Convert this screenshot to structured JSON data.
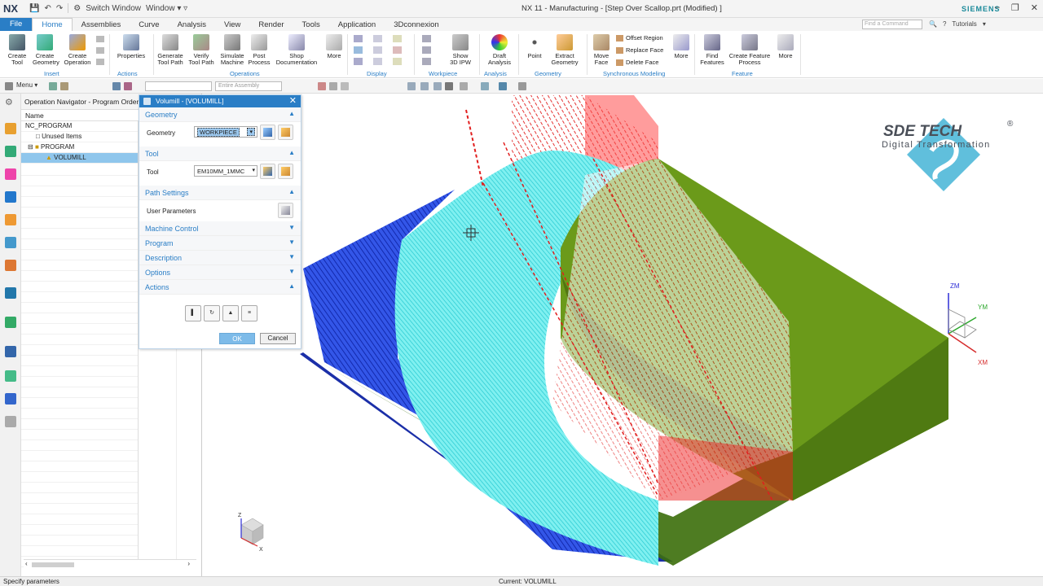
{
  "app": {
    "logo": "NX",
    "window_title": "NX 11 - Manufacturing - [Step Over Scallop.prt (Modified) ]",
    "brand": "SIEMENS",
    "qat": {
      "switch_window": "Switch Window",
      "window": "Window ▾ ▿"
    }
  },
  "ribbon_tabs": [
    "File",
    "Home",
    "Assemblies",
    "Curve",
    "Analysis",
    "View",
    "Render",
    "Tools",
    "Application",
    "3Dconnexion"
  ],
  "command_search_placeholder": "Find a Command",
  "tutorials": "Tutorials",
  "ribbon": {
    "insert": {
      "group": "Insert",
      "create_tool": "Create\nTool",
      "create_geometry": "Create\nGeometry",
      "create_operation": "Create\nOperation"
    },
    "actions": {
      "group": "Actions",
      "properties": "Properties"
    },
    "operations": {
      "group": "Operations",
      "generate": "Generate\nTool Path",
      "verify": "Verify\nTool Path",
      "simulate": "Simulate\nMachine",
      "post": "Post\nProcess",
      "shop": "Shop\nDocumentation",
      "more": "More"
    },
    "display": {
      "group": "Display"
    },
    "workpiece": {
      "group": "Workpiece",
      "show_ipw": "Show\n3D IPW"
    },
    "analysis": {
      "group": "Analysis",
      "draft": "Draft\nAnalysis"
    },
    "geometry": {
      "group": "Geometry",
      "point": "Point",
      "extract": "Extract\nGeometry"
    },
    "sync": {
      "group": "Synchronous Modeling",
      "move_face": "Move\nFace",
      "offset_region": "Offset Region",
      "replace_face": "Replace Face",
      "delete_face": "Delete Face",
      "more": "More"
    },
    "feature": {
      "group": "Feature",
      "find": "Find\nFeatures",
      "create_process": "Create Feature\nProcess",
      "more": "More"
    }
  },
  "toolbar2": {
    "menu": "Menu ▾",
    "filter": "",
    "assembly": "Entire Assembly"
  },
  "navigator": {
    "title": "Operation Navigator - Program Order",
    "column_name": "Name",
    "rows": [
      "NC_PROGRAM",
      "Unused Items",
      "PROGRAM",
      "VOLUMILL"
    ]
  },
  "dialog": {
    "title": "Volumill - [VOLUMILL]",
    "sections": {
      "geometry": "Geometry",
      "tool": "Tool",
      "path_settings": "Path Settings",
      "machine_control": "Machine Control",
      "program": "Program",
      "description": "Description",
      "options": "Options",
      "actions": "Actions"
    },
    "geometry_label": "Geometry",
    "geometry_value": "WORKPIECE",
    "tool_label": "Tool",
    "tool_value": "EM10MM_1MMC",
    "user_params_label": "User Parameters",
    "ok": "OK",
    "cancel": "Cancel"
  },
  "viewport": {
    "logo_main": "SDE TECH",
    "logo_sub": "Digital Transformation",
    "triad_labels": {
      "zm": "ZM",
      "ym": "YM",
      "xm": "XM"
    },
    "mini_triad": {
      "z": "Z",
      "x": "X"
    },
    "colors": {
      "toolpath_blue": "#1b3fd1",
      "toolpath_cyan": "#39e6e6",
      "stock_green": "#6b9a1a",
      "rapid_red": "#e11d1d"
    }
  },
  "status": {
    "prompt": "Specify parameters",
    "current": "Current: VOLUMILL"
  }
}
